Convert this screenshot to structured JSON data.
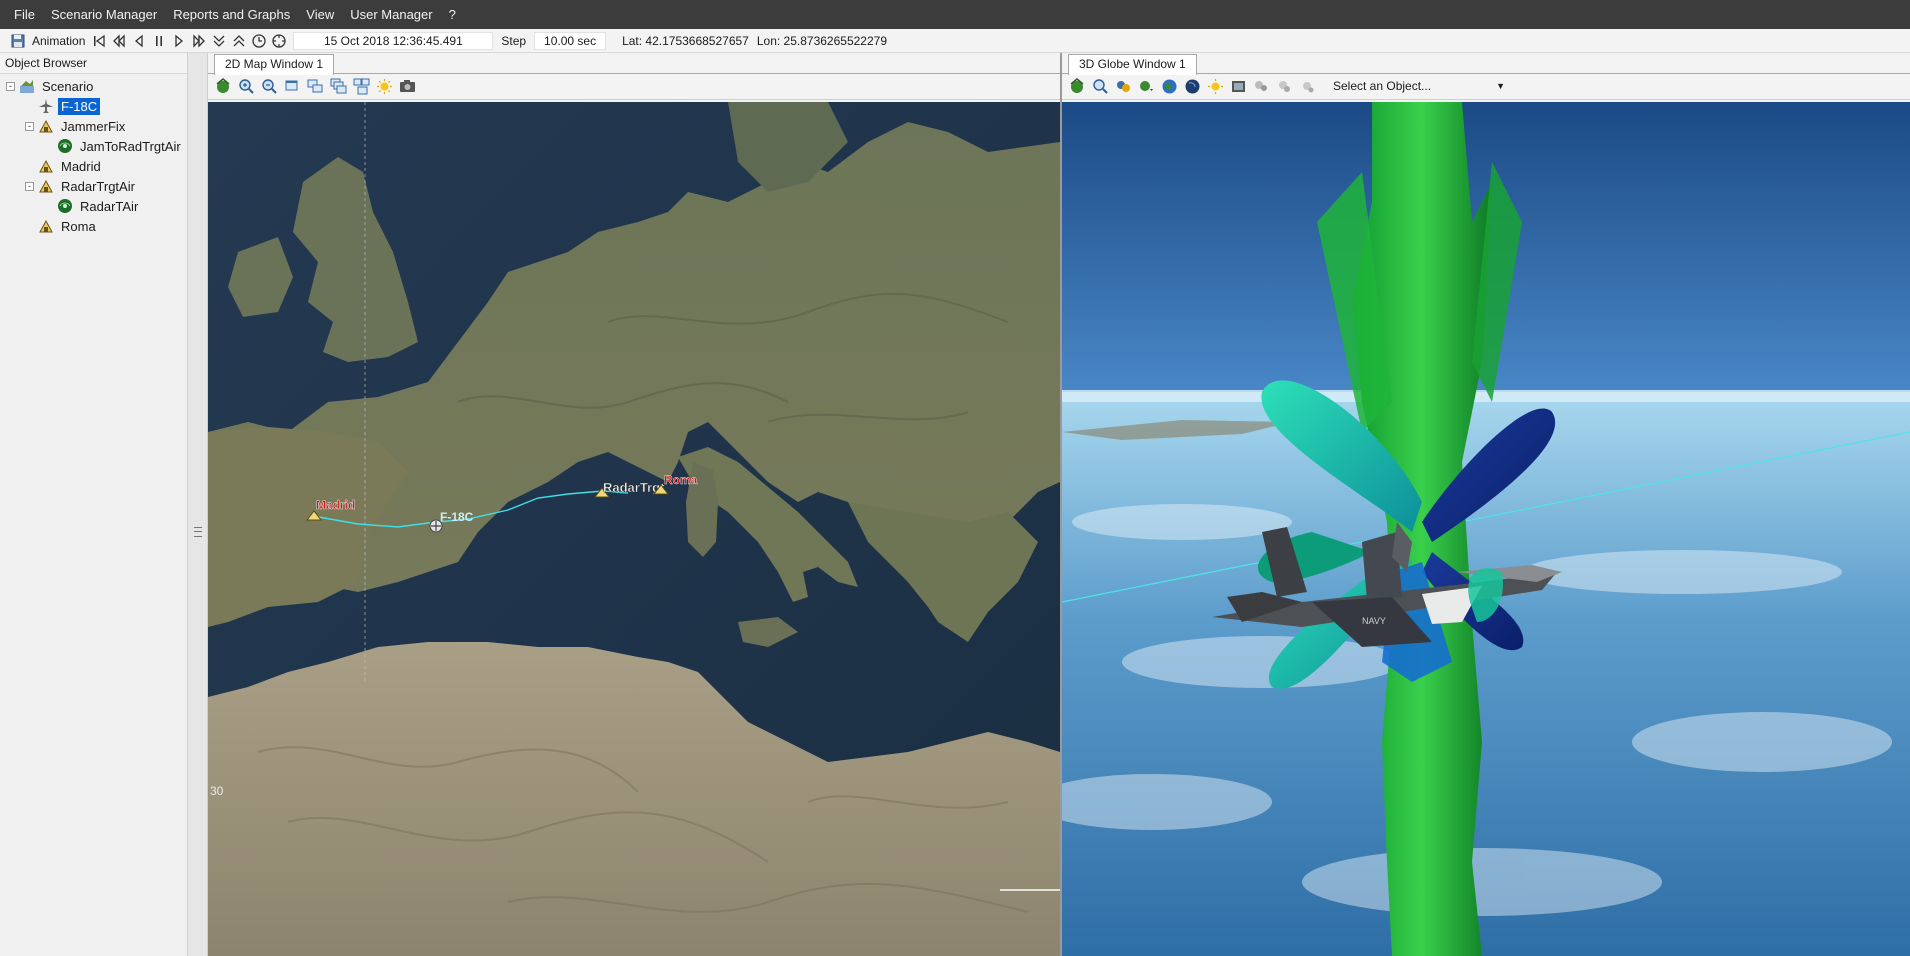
{
  "menu": [
    "File",
    "Scenario Manager",
    "Reports and Graphs",
    "View",
    "User Manager",
    "?"
  ],
  "toolbar": {
    "animation_label": "Animation",
    "datetime": "15 Oct 2018 12:36:45.491",
    "step_label": "Step",
    "step_value": "10.00 sec",
    "lat": "Lat: 42.1753668527657",
    "lon": "Lon: 25.8736265522279",
    "icons": [
      "save-icon",
      "reset-icon",
      "step-back-icon",
      "play-reverse-icon",
      "pause-icon",
      "play-icon",
      "step-forward-icon",
      "slower-icon",
      "faster-icon",
      "realtime-icon",
      "clock-icon"
    ]
  },
  "object_browser": {
    "title": "Object Browser",
    "tree": [
      {
        "label": "Scenario",
        "level": 0,
        "expand": "-",
        "icon": "scenario-icon"
      },
      {
        "label": "F-18C",
        "level": 1,
        "expand": "",
        "icon": "aircraft-icon",
        "selected": true
      },
      {
        "label": "JammerFix",
        "level": 1,
        "expand": "-",
        "icon": "facility-icon"
      },
      {
        "label": "JamToRadTrgtAir",
        "level": 2,
        "expand": "",
        "icon": "sensor-icon"
      },
      {
        "label": "Madrid",
        "level": 1,
        "expand": "",
        "icon": "facility-icon"
      },
      {
        "label": "RadarTrgtAir",
        "level": 1,
        "expand": "-",
        "icon": "facility-icon"
      },
      {
        "label": "RadarTAir",
        "level": 2,
        "expand": "",
        "icon": "sensor-icon"
      },
      {
        "label": "Roma",
        "level": 1,
        "expand": "",
        "icon": "facility-icon"
      }
    ]
  },
  "map2d": {
    "tab": "2D Map Window 1",
    "labels": {
      "madrid": "Madrid",
      "f18": "F-18C",
      "radar": "RadarTrgt",
      "roma": "Roma",
      "lat30": "30"
    },
    "colors": {
      "route": "#3fe0e8",
      "label_red": "#cc1111",
      "sea": "#1f3347"
    }
  },
  "globe3d": {
    "tab": "3D Globe Window 1",
    "select_placeholder": "Select an Object...",
    "aircraft_markings": "NAVY"
  }
}
